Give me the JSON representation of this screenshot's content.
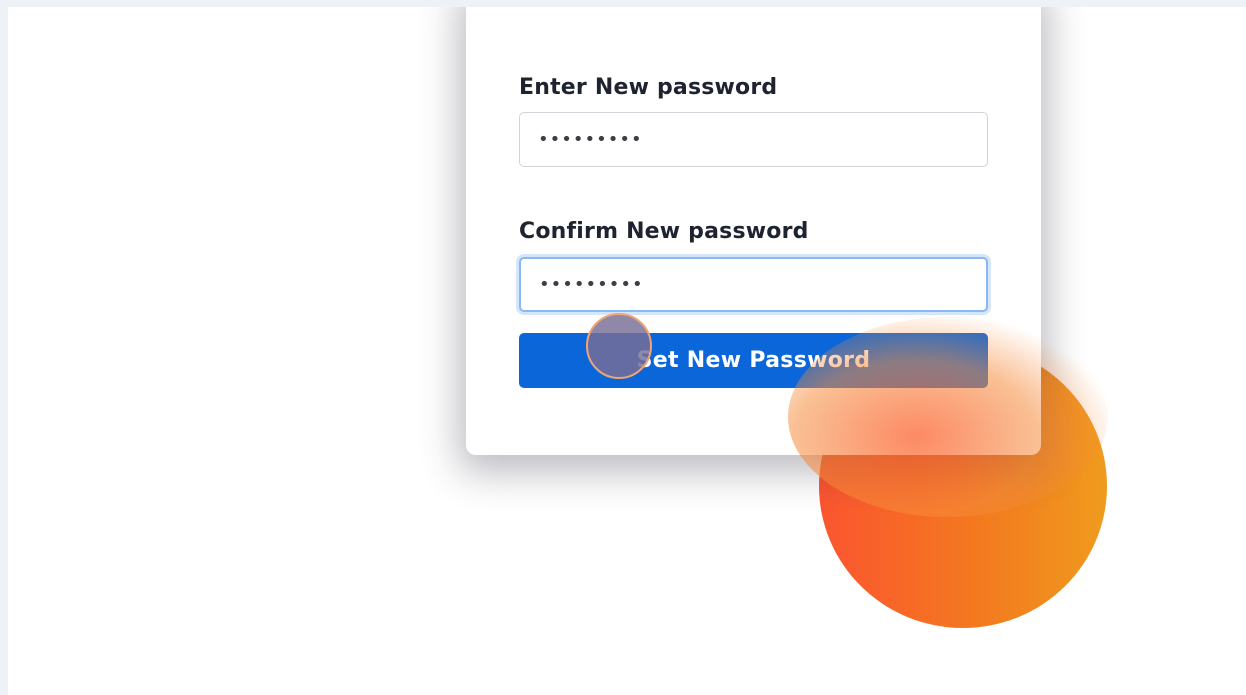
{
  "form": {
    "new_password_label": "Enter New password",
    "new_password_value": "•••••••••",
    "confirm_password_label": "Confirm New password",
    "confirm_password_value": "•••••••••",
    "submit_label": "Set New Password"
  },
  "colors": {
    "primary_button": "#0b67d9",
    "focus_ring": "#8ab8f2",
    "accent_orange": "#f3791f"
  }
}
